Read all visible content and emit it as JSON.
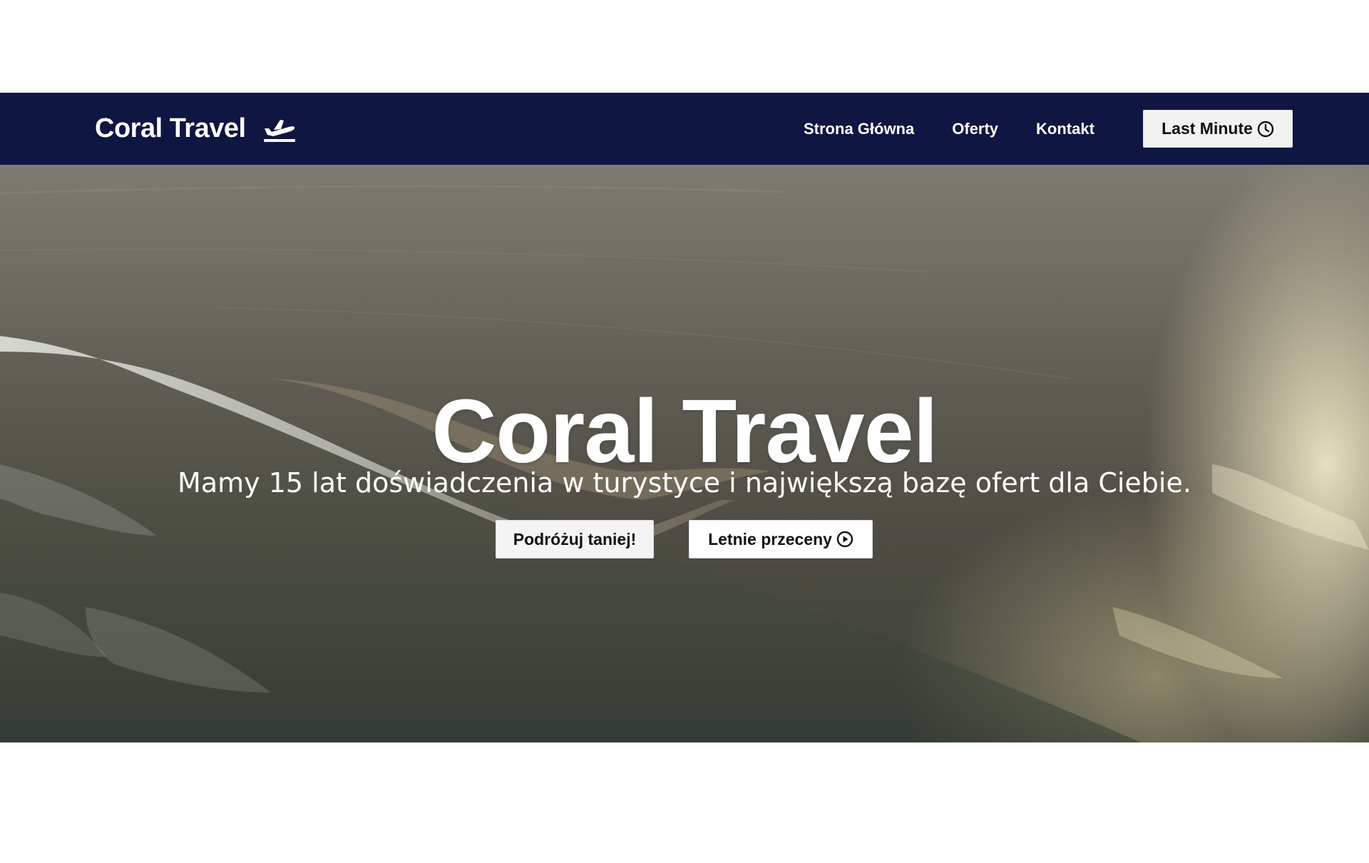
{
  "header": {
    "brand": "Coral Travel",
    "brand_icon": "plane-departure-icon",
    "nav": [
      {
        "label": "Strona Główna"
      },
      {
        "label": "Oferty"
      },
      {
        "label": "Kontakt"
      }
    ],
    "cta_label": "Last Minute",
    "cta_icon": "clock-icon"
  },
  "hero": {
    "title": "Coral Travel",
    "subtitle": "Mamy 15 lat doświadczenia w turystyce i największą bazę ofert dla Ciebie.",
    "buttons": [
      {
        "label": "Podróżuj taniej!"
      },
      {
        "label": "Letnie przeceny",
        "icon": "play-circle-icon"
      }
    ],
    "background": "aerial-ocean-wave-image"
  },
  "colors": {
    "navbar": "#0f1641",
    "text_light": "#ffffff",
    "button_bg": "#f4f4f4"
  }
}
